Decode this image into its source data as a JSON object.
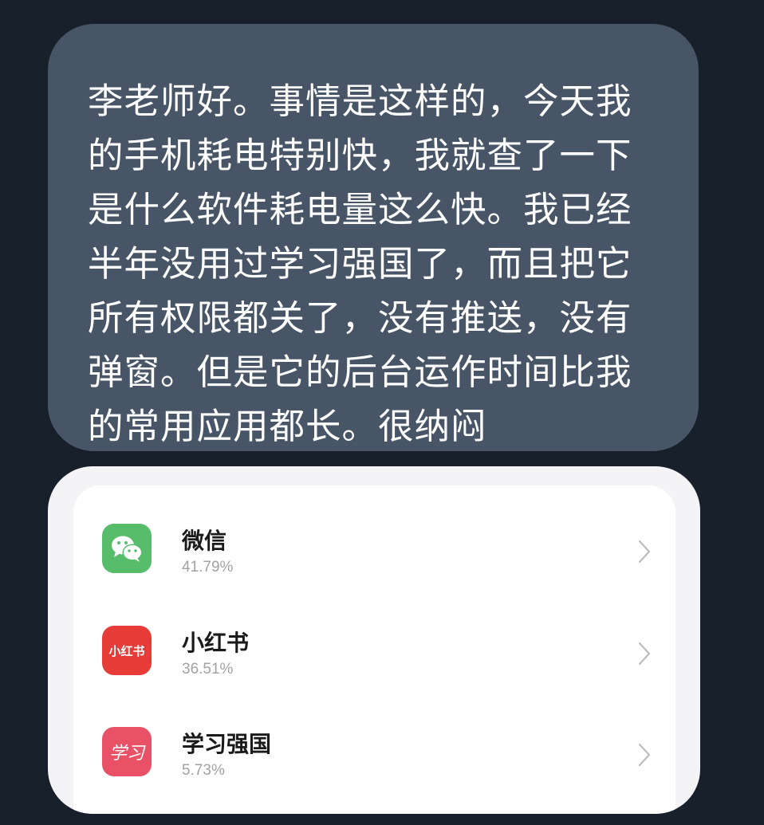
{
  "message": {
    "text": "李老师好。事情是这样的，今天我的手机耗电特别快，我就查了一下是什么软件耗电量这么快。我已经半年没用过学习强国了，而且把它所有权限都关了，没有推送，没有弹窗。但是它的后台运作时间比我的常用应用都长。很纳闷"
  },
  "battery_usage": {
    "apps": [
      {
        "name": "微信",
        "percent": "41.79%",
        "icon": "wechat-icon",
        "icon_color": "#57bd6a"
      },
      {
        "name": "小红书",
        "percent": "36.51%",
        "icon": "xiaohongshu-icon",
        "icon_label": "小红书",
        "icon_color": "#e63b36"
      },
      {
        "name": "学习强国",
        "percent": "5.73%",
        "icon": "xuexi-qiangguo-icon",
        "icon_label": "学习",
        "icon_color": "#e95266"
      }
    ]
  }
}
